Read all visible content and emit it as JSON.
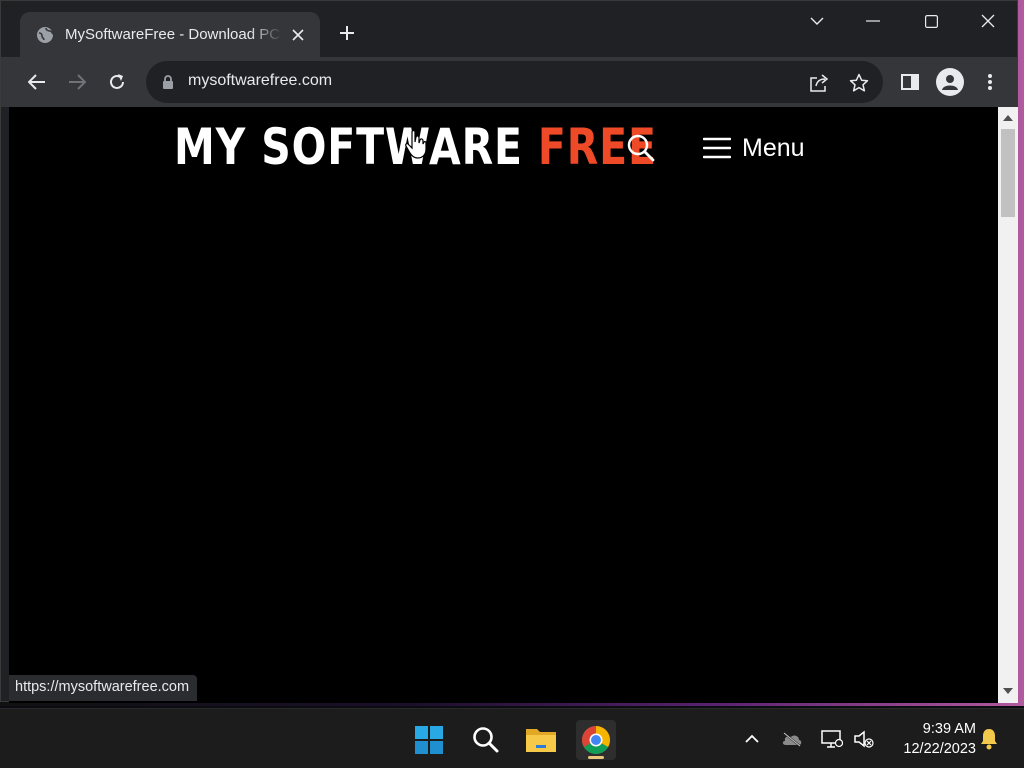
{
  "browser": {
    "tab": {
      "title": "MySoftwareFree - Download PC Software Free"
    },
    "address_bar": {
      "url": "mysoftwarefree.com"
    },
    "status_url": "https://mysoftwarefree.com"
  },
  "site": {
    "logo": {
      "part1": "MY SOFTWARE ",
      "part2": "FREE"
    },
    "menu_label": "Menu"
  },
  "taskbar": {
    "time": "9:39 AM",
    "date": "12/22/2023"
  },
  "colors": {
    "logo_accent": "#ef4a27",
    "browser_dark": "#202124",
    "toolbar": "#35363a"
  },
  "icons": {
    "tab": [
      "globe-icon",
      "close-icon",
      "plus-icon"
    ],
    "window": [
      "chevron-down-icon",
      "minimize-icon",
      "maximize-icon",
      "close-icon"
    ],
    "toolbar": [
      "back-icon",
      "forward-icon",
      "reload-icon",
      "lock-icon",
      "share-icon",
      "star-icon",
      "side-panel-icon",
      "profile-icon",
      "more-icon"
    ],
    "taskbar": [
      "windows-start-icon",
      "search-icon",
      "file-explorer-icon",
      "chrome-icon",
      "chevron-up-icon",
      "onedrive-icon",
      "network-icon",
      "volume-muted-icon",
      "notification-bell-icon"
    ]
  }
}
